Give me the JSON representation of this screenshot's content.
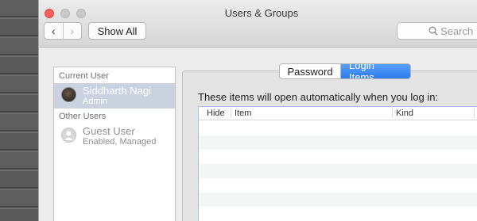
{
  "window": {
    "title": "Users & Groups"
  },
  "toolbar": {
    "back_glyph": "‹",
    "forward_glyph": "›",
    "show_all_label": "Show All",
    "search_placeholder": "Search"
  },
  "sidebar": {
    "current_user_header": "Current User",
    "current_user": {
      "name": "Siddharth Nagi",
      "role": "Admin"
    },
    "other_users_header": "Other Users",
    "other_users": [
      {
        "name": "Guest User",
        "status": "Enabled, Managed"
      }
    ]
  },
  "tabs": {
    "password": "Password",
    "login_items": "Login Items",
    "selected": "Login Items"
  },
  "login_items": {
    "caption": "These items will open automatically when you log in:",
    "columns": {
      "hide": "Hide",
      "item": "Item",
      "kind": "Kind"
    },
    "rows": []
  },
  "colors": {
    "selection": "#c9d2de",
    "tab_active": "#2d7cf0",
    "close_button": "#fc605c"
  },
  "icons": [
    "back-arrow-icon",
    "forward-arrow-icon",
    "search-icon",
    "user-avatar",
    "guest-avatar-icon"
  ]
}
